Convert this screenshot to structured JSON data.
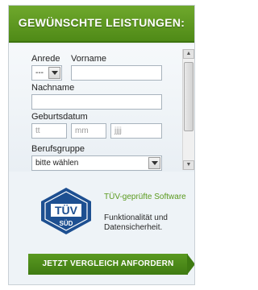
{
  "header": {
    "title": "GEWÜNSCHTE LEISTUNGEN:"
  },
  "form": {
    "anrede_label": "Anrede",
    "anrede_value": "---",
    "vorname_label": "Vorname",
    "vorname_value": "",
    "nachname_label": "Nachname",
    "nachname_value": "",
    "geburtsdatum_label": "Geburtsdatum",
    "day_placeholder": "tt",
    "month_placeholder": "mm",
    "year_placeholder": "jjjj",
    "berufsgruppe_label": "Berufsgruppe",
    "berufsgruppe_value": "bitte wählen"
  },
  "badge": {
    "seal_text": "TÜV",
    "seal_subtext": "SÜD",
    "title": "TÜV-geprüfte Software",
    "description": "Funktionalität und Datensicherheit."
  },
  "cta": {
    "label": "JETZT VERGLEICH ANFORDERN"
  },
  "colors": {
    "accent": "#4f8a17",
    "seal": "#1d4f91"
  }
}
